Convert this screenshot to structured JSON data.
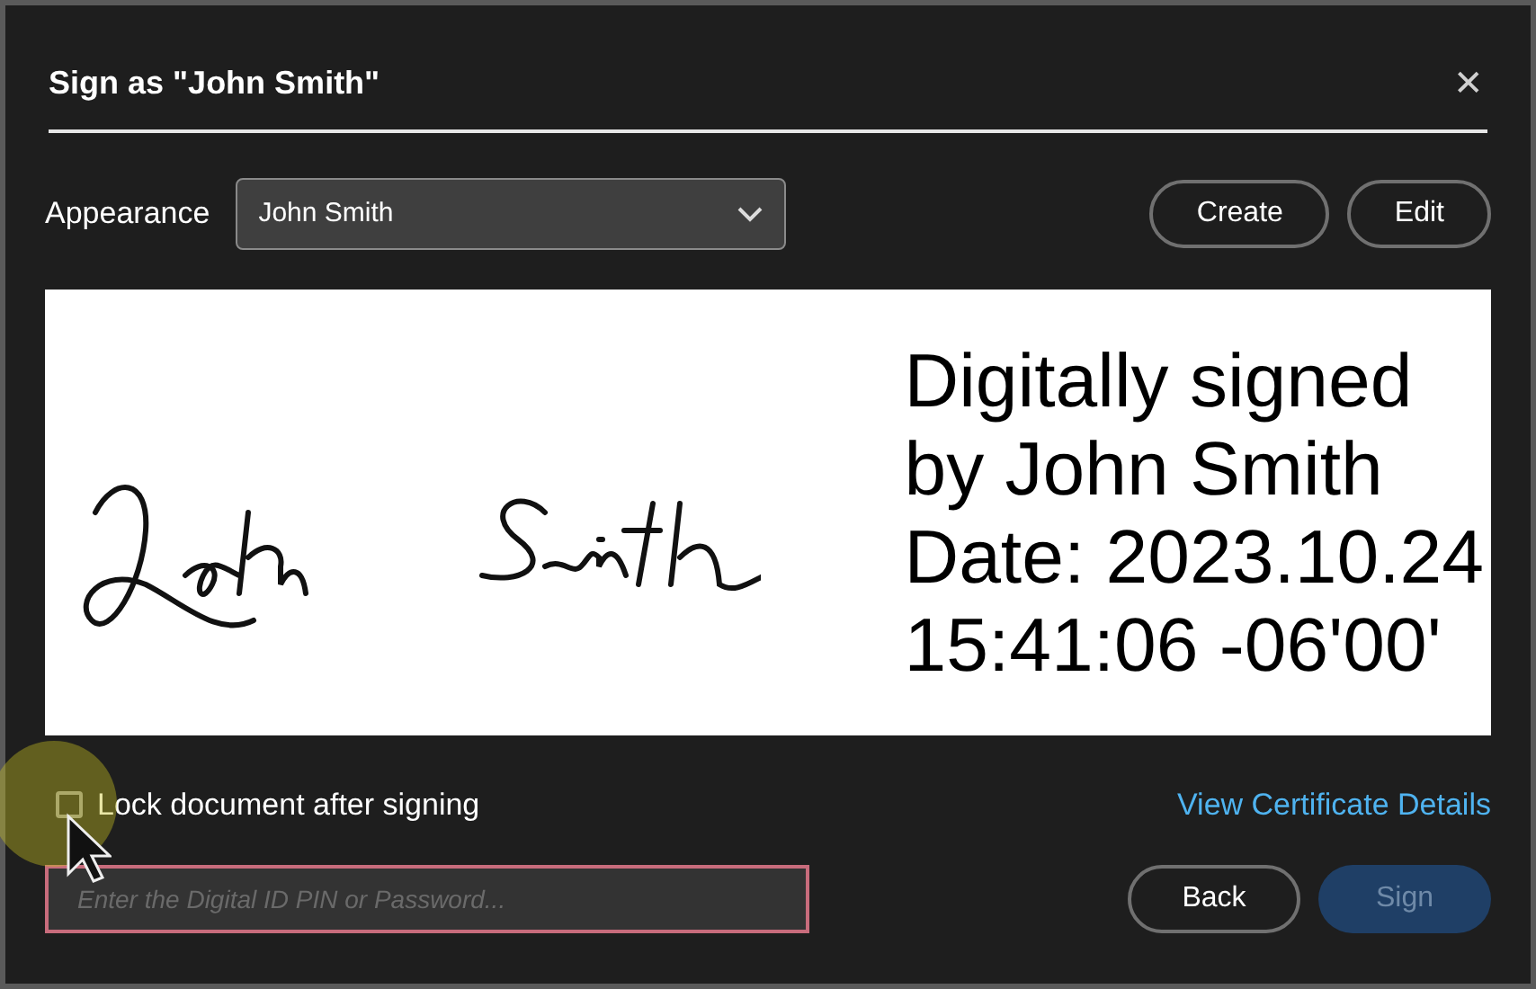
{
  "dialog": {
    "title": "Sign as \"John Smith\"",
    "close": "✕"
  },
  "appearance": {
    "label": "Appearance",
    "value": "John Smith"
  },
  "buttons_top": [
    "Create",
    "Edit"
  ],
  "preview": {
    "lines": [
      "Digitally signed",
      "by John Smith",
      "Date: 2023.10.24",
      "15:41:06 -06'00'"
    ]
  },
  "lock": {
    "label": "Lock document after signing",
    "checked": false
  },
  "certificate_link": "View Certificate Details",
  "pin_field": {
    "placeholder": "Enter the Digital ID PIN or Password..."
  },
  "buttons_bottom": [
    {
      "label": "Back",
      "disabled": false
    },
    {
      "label": "Sign",
      "disabled": true
    }
  ]
}
